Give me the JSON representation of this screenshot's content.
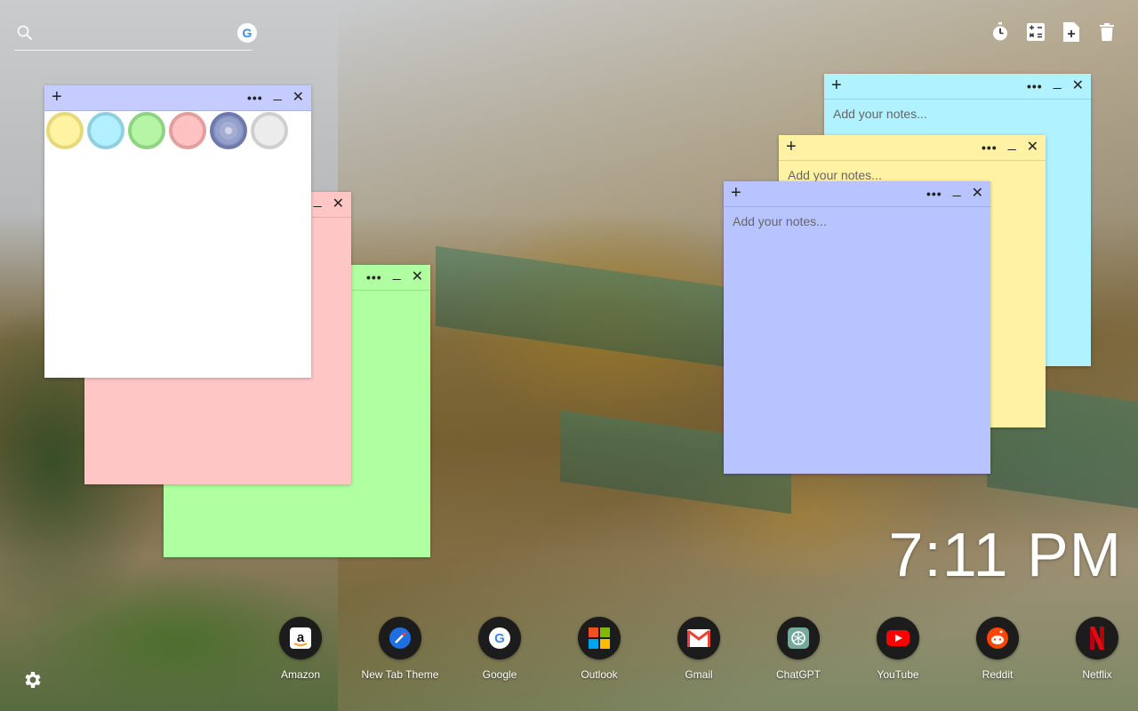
{
  "search": {
    "placeholder": "",
    "value": "",
    "engine_badge": "G",
    "engine_icon": "google-icon"
  },
  "toolbar": [
    {
      "name": "timer-icon"
    },
    {
      "name": "calculator-icon"
    },
    {
      "name": "new-note-icon"
    },
    {
      "name": "trash-icon"
    }
  ],
  "notes": {
    "add_label": "+",
    "menu_label": "•••",
    "minimize_label": "_",
    "close_label": "✕",
    "placeholder": "Add your notes...",
    "colors": {
      "white": "#ffffff",
      "pink": "#ffc6c6",
      "green": "#b0ffa0",
      "cyan": "#b0f2ff",
      "yellow": "#fff2a4",
      "blue": "#b8c4ff",
      "header_blue": "#c5ccff"
    }
  },
  "swatches": [
    {
      "name": "yellow",
      "color": "#fff2a0",
      "ring": "#e7d97a"
    },
    {
      "name": "cyan",
      "color": "#b3f0ff",
      "ring": "#8fd0df"
    },
    {
      "name": "green",
      "color": "#b6f5a6",
      "ring": "#8ed482"
    },
    {
      "name": "pink",
      "color": "#ffc2c2",
      "ring": "#e39e9e"
    },
    {
      "name": "blue",
      "color": "#8793c4",
      "ring": "#6e7aab",
      "selected": true
    },
    {
      "name": "gray",
      "color": "#ececec",
      "ring": "#cfcfcf"
    }
  ],
  "clock": {
    "time": "7:11 PM"
  },
  "apps": [
    {
      "label": "Amazon",
      "icon": "amazon-icon"
    },
    {
      "label": "New Tab Theme",
      "icon": "new-tab-theme-icon"
    },
    {
      "label": "Google",
      "icon": "google-icon"
    },
    {
      "label": "Outlook",
      "icon": "outlook-icon"
    },
    {
      "label": "Gmail",
      "icon": "gmail-icon"
    },
    {
      "label": "ChatGPT",
      "icon": "chatgpt-icon"
    },
    {
      "label": "YouTube",
      "icon": "youtube-icon"
    },
    {
      "label": "Reddit",
      "icon": "reddit-icon"
    },
    {
      "label": "Netflix",
      "icon": "netflix-icon"
    }
  ],
  "settings": {
    "icon": "gear-icon"
  }
}
